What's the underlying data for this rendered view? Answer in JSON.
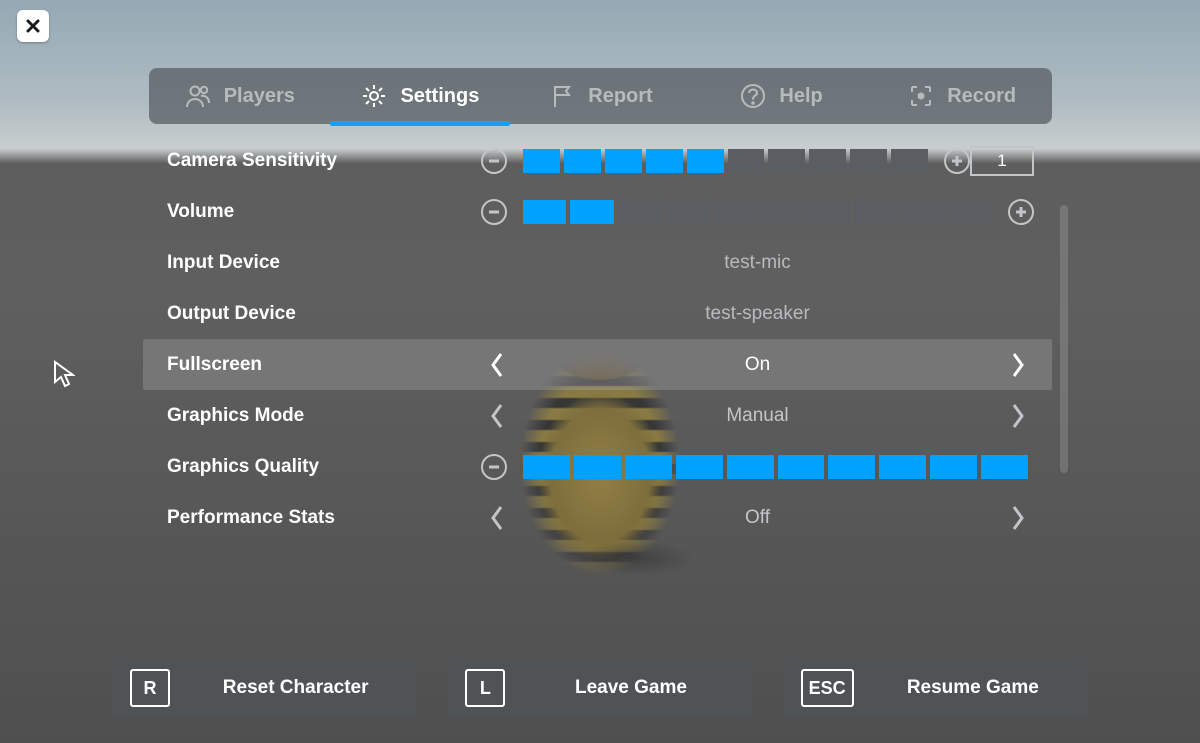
{
  "close": {
    "glyph": "X"
  },
  "tabs": [
    {
      "id": "players",
      "label": "Players",
      "icon": "players-icon",
      "active": false
    },
    {
      "id": "settings",
      "label": "Settings",
      "icon": "gear-icon",
      "active": true
    },
    {
      "id": "report",
      "label": "Report",
      "icon": "flag-icon",
      "active": false
    },
    {
      "id": "help",
      "label": "Help",
      "icon": "help-icon",
      "active": false
    },
    {
      "id": "record",
      "label": "Record",
      "icon": "record-icon",
      "active": false
    }
  ],
  "settings": {
    "camera_sensitivity": {
      "label": "Camera Sensitivity",
      "value": 5,
      "max": 10,
      "text_value": "1"
    },
    "volume": {
      "label": "Volume",
      "value": 2,
      "max": 10
    },
    "input_device": {
      "label": "Input Device",
      "value": "test-mic"
    },
    "output_device": {
      "label": "Output Device",
      "value": "test-speaker"
    },
    "fullscreen": {
      "label": "Fullscreen",
      "value": "On"
    },
    "graphics_mode": {
      "label": "Graphics Mode",
      "value": "Manual"
    },
    "graphics_quality": {
      "label": "Graphics Quality",
      "value": 10,
      "max": 10
    },
    "performance_stats": {
      "label": "Performance Stats",
      "value": "Off"
    }
  },
  "actions": {
    "reset": {
      "key": "R",
      "label": "Reset Character"
    },
    "leave": {
      "key": "L",
      "label": "Leave Game"
    },
    "resume": {
      "key": "ESC",
      "label": "Resume Game"
    }
  }
}
